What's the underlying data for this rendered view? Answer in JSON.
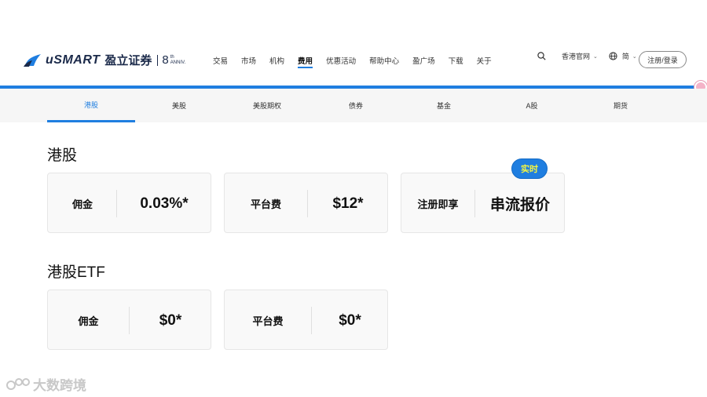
{
  "brand": {
    "name": "uSMART",
    "name_cn": "盈立证券",
    "anniv_number": "8",
    "anniv_suffix": "th",
    "anniv_text": "ANNIV.",
    "colors": {
      "primary": "#1f7ee0",
      "logo": "#1b2a4a",
      "badge_text": "#f5f541"
    }
  },
  "nav": {
    "items": [
      "交易",
      "市场",
      "机构",
      "费用",
      "优惠活动",
      "帮助中心",
      "盈广场",
      "下载",
      "关于"
    ],
    "active": "费用"
  },
  "tools": {
    "search_icon": "search-icon",
    "site_label": "香港官网",
    "lang_icon": "globe-icon",
    "lang_label": "简",
    "register_label": "注册/登录"
  },
  "tabs": {
    "items": [
      "港股",
      "美股",
      "美股期权",
      "债券",
      "基金",
      "A股",
      "期货"
    ],
    "active": "港股"
  },
  "sections": [
    {
      "title": "港股",
      "cards": [
        {
          "label": "佣金",
          "value": "0.03%*"
        },
        {
          "label": "平台费",
          "value": "$12*"
        },
        {
          "label": "注册即享",
          "value": "串流报价",
          "badge": "实时"
        }
      ]
    },
    {
      "title": "港股ETF",
      "cards": [
        {
          "label": "佣金",
          "value": "$0*"
        },
        {
          "label": "平台费",
          "value": "$0*"
        }
      ]
    }
  ],
  "watermark": {
    "text": "大数跨境"
  }
}
